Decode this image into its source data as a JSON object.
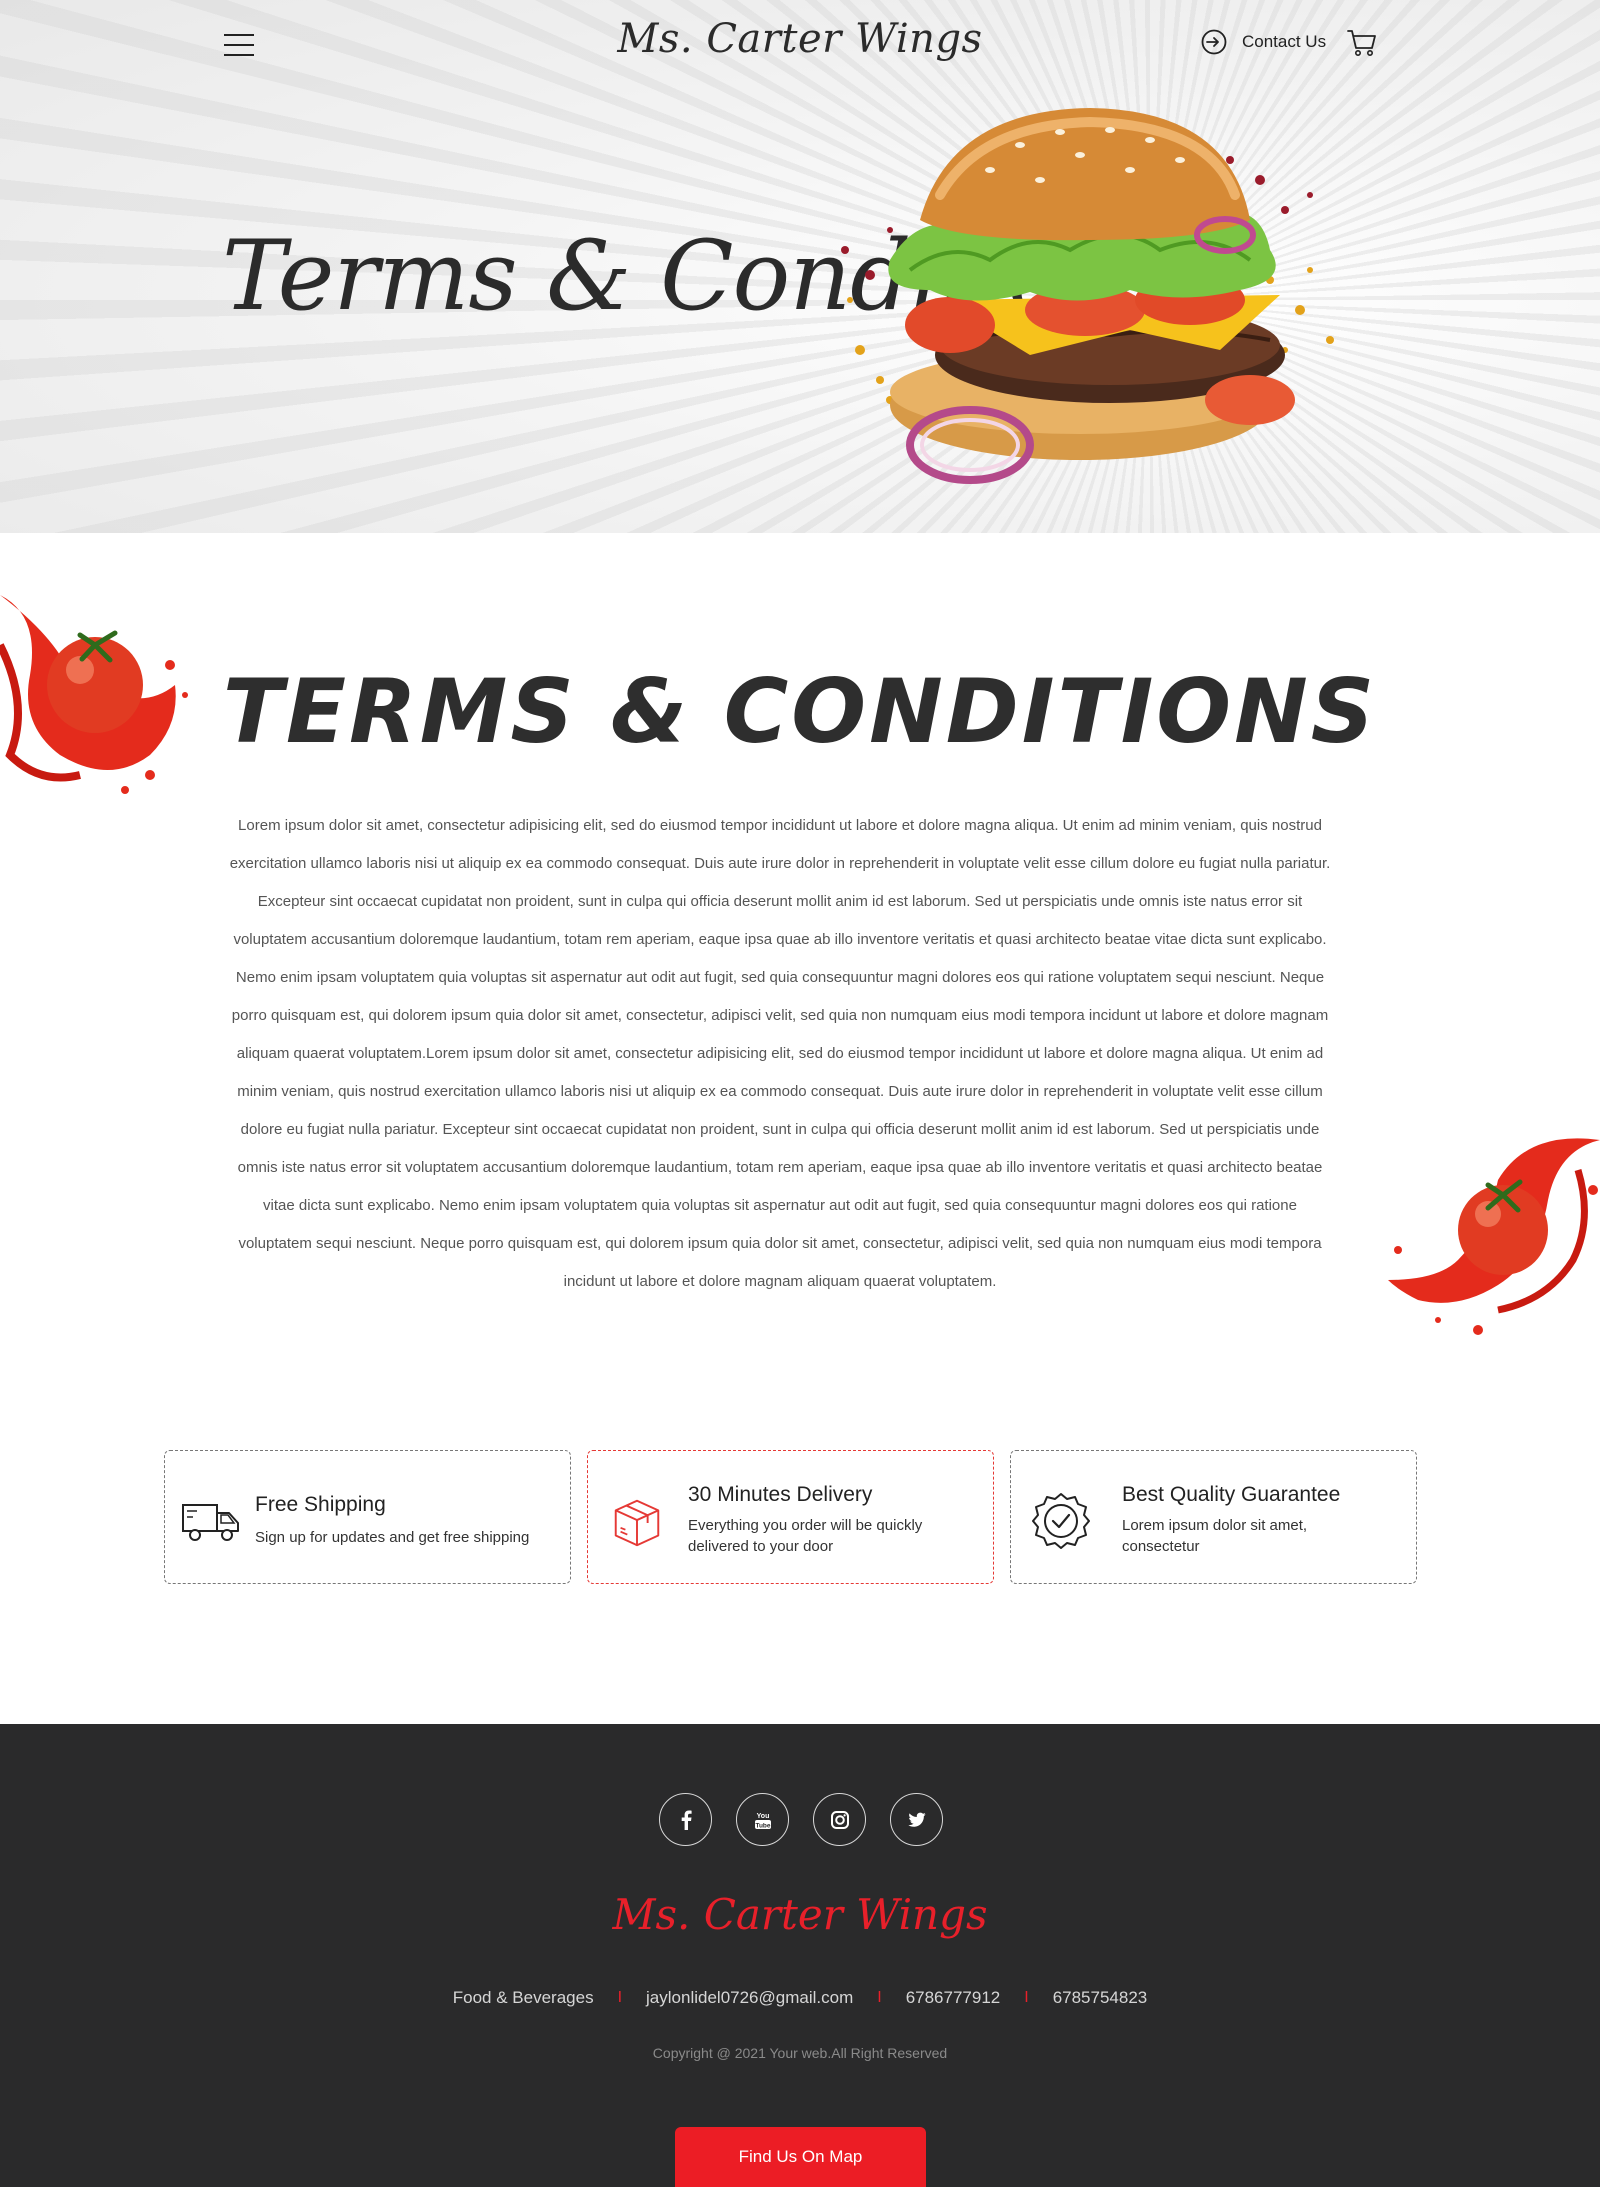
{
  "header": {
    "logo": "Ms. Carter Wings",
    "contact_label": "Contact Us",
    "icons": {
      "menu": "hamburger-menu-icon",
      "contact": "login-arrow-icon",
      "cart": "shopping-cart-icon"
    }
  },
  "hero": {
    "title": "Terms & Condition"
  },
  "main": {
    "heading": "TERMS & CONDITIONS",
    "body": "Lorem ipsum dolor sit amet, consectetur adipisicing elit, sed do eiusmod tempor incididunt ut labore et dolore magna aliqua. Ut enim ad minim veniam, quis nostrud exercitation ullamco laboris nisi ut aliquip ex ea commodo consequat. Duis aute irure dolor in reprehenderit in voluptate velit esse cillum dolore eu fugiat nulla pariatur. Excepteur sint occaecat cupidatat non proident, sunt in culpa qui officia deserunt mollit anim id est laborum. Sed ut perspiciatis unde omnis iste natus error sit voluptatem accusantium doloremque laudantium, totam rem aperiam, eaque ipsa quae ab illo inventore veritatis et quasi architecto beatae vitae dicta sunt explicabo. Nemo enim ipsam voluptatem quia voluptas sit aspernatur aut odit aut fugit, sed quia consequuntur magni dolores eos qui ratione voluptatem sequi nesciunt. Neque porro quisquam est, qui dolorem ipsum quia dolor sit amet, consectetur, adipisci velit, sed quia non numquam eius modi tempora incidunt ut labore et dolore magnam aliquam quaerat voluptatem.Lorem ipsum dolor sit amet, consectetur adipisicing elit, sed do eiusmod tempor incididunt ut labore et dolore magna aliqua. Ut enim ad minim veniam, quis nostrud exercitation ullamco laboris nisi ut aliquip ex ea commodo consequat. Duis aute irure dolor in reprehenderit in voluptate velit esse cillum dolore eu fugiat nulla pariatur. Excepteur sint occaecat cupidatat non proident, sunt in culpa qui officia deserunt mollit anim id est laborum. Sed ut perspiciatis unde omnis iste natus error sit voluptatem accusantium doloremque laudantium, totam rem aperiam, eaque ipsa quae ab illo inventore veritatis et quasi architecto beatae vitae dicta sunt explicabo. Nemo enim ipsam voluptatem quia voluptas sit aspernatur aut odit aut fugit, sed quia consequuntur magni dolores eos qui ratione voluptatem sequi nesciunt. Neque porro quisquam est, qui dolorem ipsum quia dolor sit amet, consectetur, adipisci velit, sed quia non numquam eius modi tempora incidunt ut labore et dolore magnam aliquam quaerat voluptatem."
  },
  "features": [
    {
      "title": "Free Shipping",
      "desc": "Sign up for updates and get free shipping",
      "icon": "delivery-truck-icon"
    },
    {
      "title": "30 Minutes Delivery",
      "desc": "Everything you order will be quickly delivered to your door",
      "icon": "package-box-icon"
    },
    {
      "title": "Best Quality Guarantee",
      "desc": "Lorem ipsum dolor sit amet, consectetur",
      "icon": "quality-badge-icon"
    }
  ],
  "footer": {
    "social": [
      "facebook-icon",
      "youtube-icon",
      "instagram-icon",
      "twitter-icon"
    ],
    "logo": "Ms. Carter Wings",
    "info": [
      "Food & Beverages",
      "jaylonlidel0726@gmail.com",
      "6786777912",
      "6785754823"
    ],
    "separator": "I",
    "copyright": "Copyright @ 2021 Your web.All Right Reserved",
    "map_button": "Find Us On Map"
  },
  "colors": {
    "accent": "#ec1d25",
    "footer_bg": "#2a2a2b",
    "text_dark": "#2b2b2b"
  }
}
